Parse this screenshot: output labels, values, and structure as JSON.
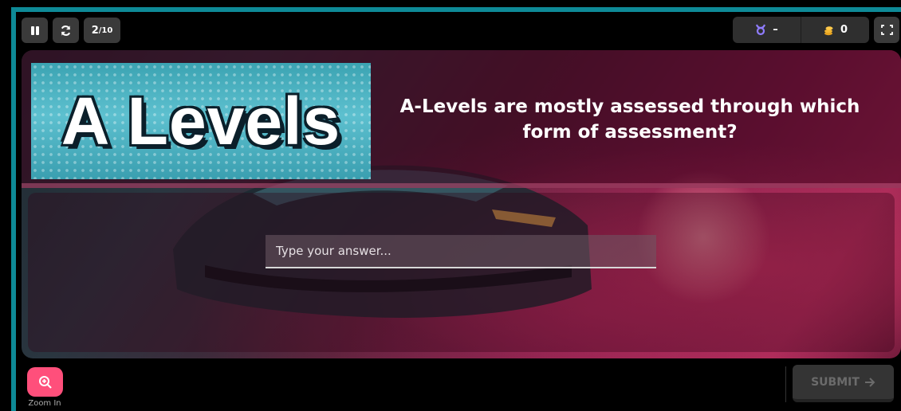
{
  "topbar": {
    "pause_icon": "pause-icon",
    "reload_icon": "reload-icon",
    "counter_current": "2",
    "counter_total": "/10",
    "streak_value": "–",
    "coins_value": "0",
    "fullscreen_icon": "fullscreen-icon"
  },
  "question": {
    "image_text": "A Levels",
    "text": "A-Levels are mostly assessed through which form of assessment?"
  },
  "answer": {
    "placeholder": "Type your answer..."
  },
  "footer": {
    "zoom_label": "Zoom In",
    "submit_label": "SUBMIT"
  },
  "colors": {
    "accent_pink": "#ff4f7b",
    "border_teal": "#0e8a97"
  }
}
